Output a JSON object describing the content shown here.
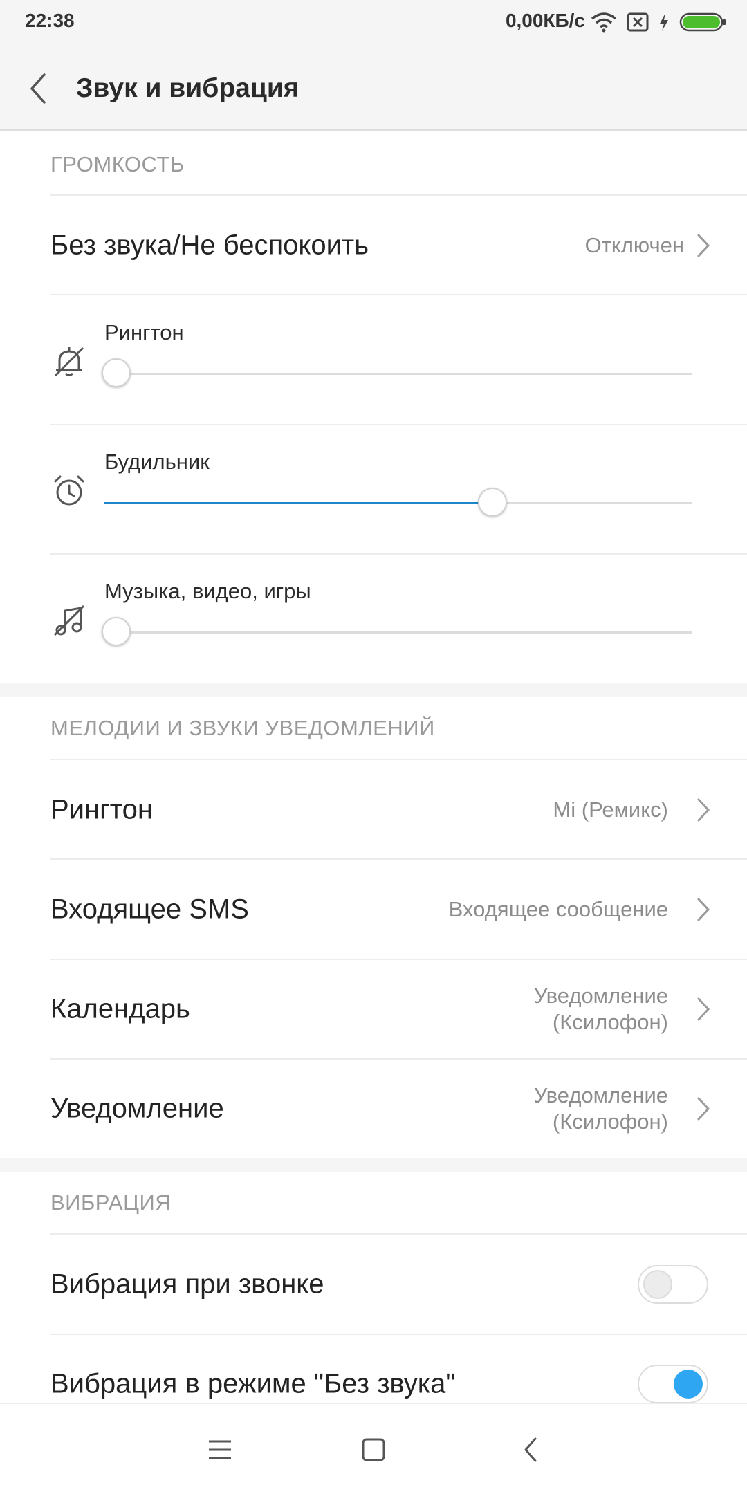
{
  "status_bar": {
    "time": "22:38",
    "network_speed": "0,00КБ/с",
    "icons": [
      "wifi-icon",
      "no-sim-icon",
      "charging-icon",
      "battery-icon"
    ],
    "battery_color": "#4cbd2c"
  },
  "header": {
    "title": "Звук и вибрация",
    "back_icon": "back-arrow-icon"
  },
  "volume_section": {
    "title": "ГРОМКОСТЬ",
    "silent_mode": {
      "label": "Без звука/Не беспокоить",
      "value": "Отключен"
    },
    "sliders": [
      {
        "label": "Рингтон",
        "icon": "bell-muted-icon",
        "level": 0.02
      },
      {
        "label": "Будильник",
        "icon": "alarm-clock-icon",
        "level": 0.66
      },
      {
        "label": "Музыка, видео, игры",
        "icon": "music-muted-icon",
        "level": 0.02
      }
    ]
  },
  "sounds_section": {
    "title": "МЕЛОДИИ И ЗВУКИ УВЕДОМЛЕНИЙ",
    "items": [
      {
        "label": "Рингтон",
        "value": "Mi (Ремикс)"
      },
      {
        "label": "Входящее SMS",
        "value": "Входящее сообщение"
      },
      {
        "label": "Календарь",
        "value_line1": "Уведомление",
        "value_line2": "(Ксилофон)"
      },
      {
        "label": "Уведомление",
        "value_line1": "Уведомление",
        "value_line2": "(Ксилофон)"
      }
    ]
  },
  "vibration_section": {
    "title": "ВИБРАЦИЯ",
    "items": [
      {
        "label": "Вибрация при звонке",
        "enabled": false
      },
      {
        "label": "Вибрация в режиме \"Без звука\"",
        "enabled": true
      }
    ]
  },
  "nav_bar": {
    "buttons": [
      "menu-icon",
      "home-icon",
      "back-icon"
    ]
  },
  "colors": {
    "accent": "#1f86c9",
    "toggle_on": "#2fa6f2",
    "section_header": "#9a9a9a",
    "secondary_text": "#8c8c8c"
  }
}
